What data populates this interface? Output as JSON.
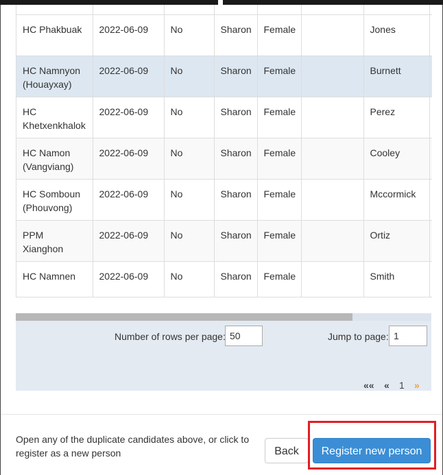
{
  "table": {
    "rows": [
      {
        "facility": "HC Phakbuak",
        "date": "2022-06-09",
        "flag": "No",
        "first_name": "Sharon",
        "sex": "Female",
        "extra": "",
        "last_name": "Jones"
      },
      {
        "facility": "HC Namnyon (Houayxay)",
        "date": "2022-06-09",
        "flag": "No",
        "first_name": "Sharon",
        "sex": "Female",
        "extra": "",
        "last_name": "Burnett"
      },
      {
        "facility": "HC Khetxenkhalok",
        "date": "2022-06-09",
        "flag": "No",
        "first_name": "Sharon",
        "sex": "Female",
        "extra": "",
        "last_name": "Perez"
      },
      {
        "facility": "HC Namon (Vangviang)",
        "date": "2022-06-09",
        "flag": "No",
        "first_name": "Sharon",
        "sex": "Female",
        "extra": "",
        "last_name": "Cooley"
      },
      {
        "facility": "HC Somboun (Phouvong)",
        "date": "2022-06-09",
        "flag": "No",
        "first_name": "Sharon",
        "sex": "Female",
        "extra": "",
        "last_name": "Mccormick"
      },
      {
        "facility": "PPM Xianghon",
        "date": "2022-06-09",
        "flag": "No",
        "first_name": "Sharon",
        "sex": "Female",
        "extra": "",
        "last_name": "Ortiz"
      },
      {
        "facility": "HC Namnen",
        "date": "2022-06-09",
        "flag": "No",
        "first_name": "Sharon",
        "sex": "Female",
        "extra": "",
        "last_name": "Smith"
      }
    ]
  },
  "pager": {
    "rows_per_page_label": "Number of rows per page:",
    "rows_per_page_value": "50",
    "jump_label": "Jump to page:",
    "jump_value": "1",
    "first_label": "««",
    "prev_label": "«",
    "current_page": "1",
    "next_label": "»"
  },
  "footer": {
    "message": "Open any of the duplicate candidates above, or click to register as a new person",
    "back_label": "Back",
    "register_label": "Register new person"
  },
  "colors": {
    "primary_button": "#3b8ed5",
    "highlighted_row": "#dde7f1",
    "pager_background": "#e3eaf2",
    "annotation_box": "#e41c23"
  }
}
